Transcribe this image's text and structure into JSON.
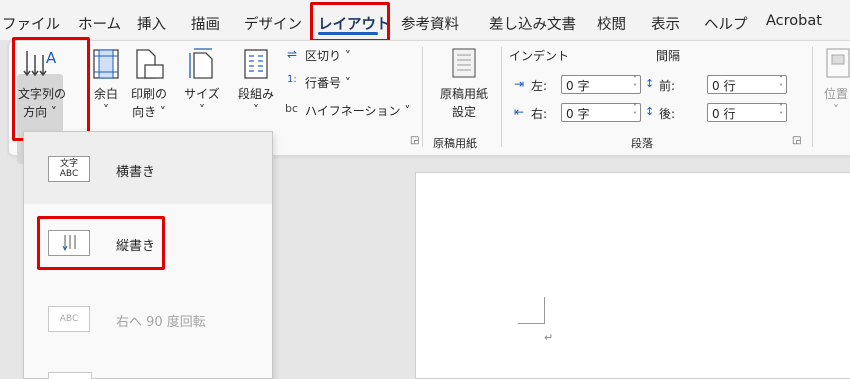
{
  "menu": {
    "tabs": [
      "ファイル",
      "ホーム",
      "挿入",
      "描画",
      "デザイン",
      "レイアウト",
      "参考資料",
      "差し込み文書",
      "校閲",
      "表示",
      "ヘルプ",
      "Acrobat"
    ],
    "active_tab": "レイアウト"
  },
  "ribbon": {
    "text_direction": {
      "label_line1": "文字列の",
      "label_line2": "方向 ˅"
    },
    "margins": {
      "label_line1": "余白",
      "label_line2": "˅"
    },
    "orientation": {
      "label_line1": "印刷の",
      "label_line2": "向き ˅"
    },
    "size": {
      "label_line1": "サイズ",
      "label_line2": "˅"
    },
    "columns": {
      "label_line1": "段組み",
      "label_line2": "˅"
    },
    "breaks": "区切り ˅",
    "line_numbers": "行番号 ˅",
    "hyphenation": "ハイフネーション ˅",
    "genko": {
      "label_line1": "原稿用紙",
      "label_line2": "設定",
      "group": "原稿用紙"
    },
    "indent": {
      "title": "インデント",
      "left_label": "左:",
      "left_value": "0 字",
      "right_label": "右:",
      "right_value": "0 字"
    },
    "spacing": {
      "title": "間隔",
      "before_label": "前:",
      "before_value": "0 行",
      "after_label": "後:",
      "after_value": "0 行"
    },
    "paragraph_group": "段落",
    "position": {
      "label": "位置",
      "chevron": "˅"
    }
  },
  "dropdown": {
    "items": [
      {
        "label": "横書き",
        "icon_text": "文字ABC",
        "enabled": true
      },
      {
        "label": "縦書き",
        "icon_text": "縦",
        "enabled": true
      },
      {
        "label": "右へ 90 度回転",
        "icon_text": "ABC",
        "enabled": false
      }
    ]
  },
  "document": {
    "paragraph_mark": "↵"
  },
  "colors": {
    "highlight_red": "#e00000",
    "active_tab_underline": "#1c5dbf"
  }
}
